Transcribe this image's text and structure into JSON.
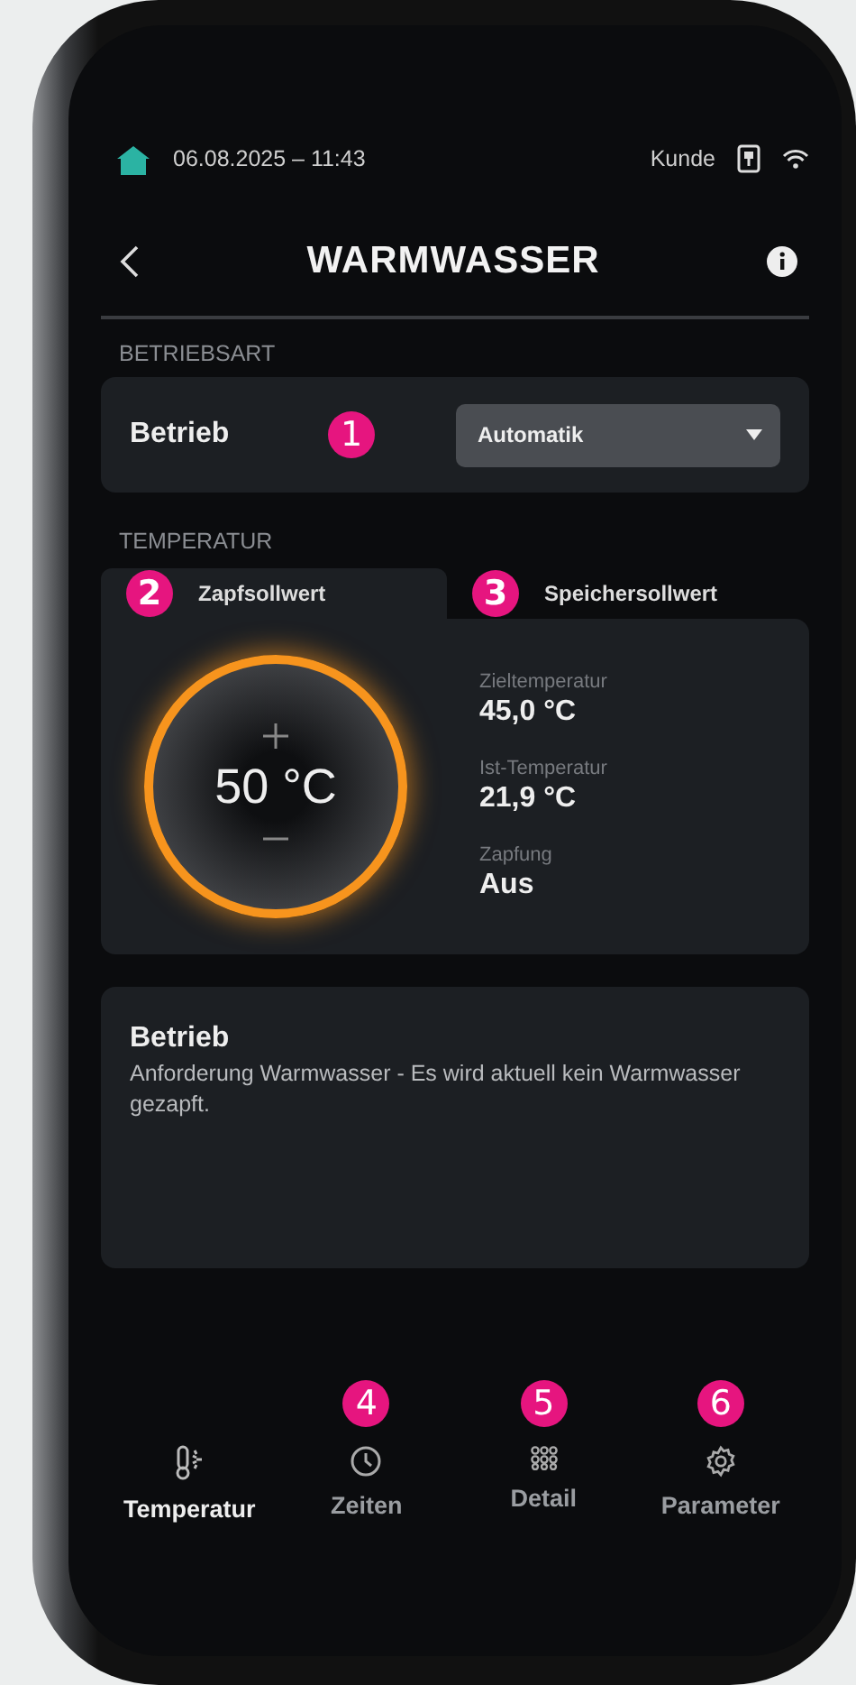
{
  "status_bar": {
    "datetime": "06.08.2025 – 11:43",
    "user": "Kunde"
  },
  "header": {
    "title": "WARMWASSER"
  },
  "betriebsart": {
    "section_label": "BETRIEBSART",
    "label": "Betrieb",
    "callout": "1",
    "dropdown": {
      "value": "Automatik"
    }
  },
  "temperatur": {
    "section_label": "TEMPERATUR",
    "tabs": [
      {
        "label": "Zapfsollwert",
        "selected": true,
        "callout": "2"
      },
      {
        "label": "Speichersollwert",
        "selected": false,
        "callout": "3"
      }
    ],
    "dial": {
      "value": "50 °C"
    },
    "readings": [
      {
        "label": "Zieltemperatur",
        "value": "45,0 °C"
      },
      {
        "label": "Ist-Temperatur",
        "value": "21,9 °C"
      },
      {
        "label": "Zapfung",
        "value": "Aus"
      }
    ]
  },
  "info_card": {
    "title": "Betrieb",
    "text": "Anforderung Warmwasser - Es wird aktuell kein Warmwasser gezapft."
  },
  "bottom_nav": [
    {
      "kind": "thermometer",
      "label": "Temperatur",
      "selected": true
    },
    {
      "kind": "clock",
      "label": "Zeiten",
      "selected": false,
      "callout": "4"
    },
    {
      "kind": "grid",
      "label": "Detail",
      "selected": false,
      "callout": "5"
    },
    {
      "kind": "gear",
      "label": "Parameter",
      "selected": false,
      "callout": "6"
    }
  ]
}
